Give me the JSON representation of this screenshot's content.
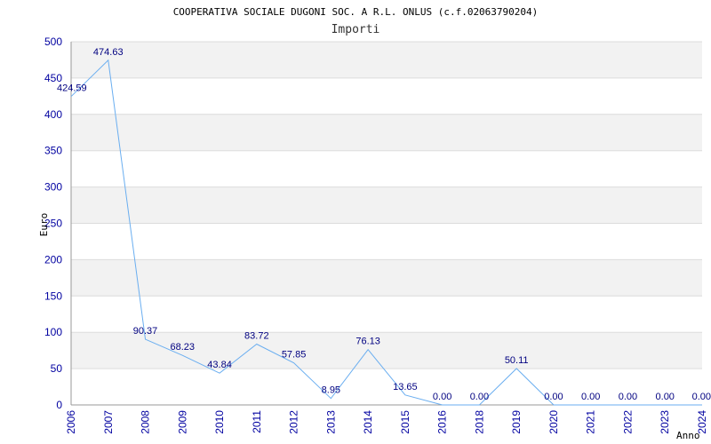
{
  "chart_data": {
    "type": "line",
    "title": "COOPERATIVA SOCIALE DUGONI SOC. A R.L. ONLUS (c.f.02063790204)",
    "subtitle": "Importi",
    "xlabel": "Anno",
    "ylabel": "Euro",
    "ylim": [
      0,
      500
    ],
    "yticks": [
      0,
      50,
      100,
      150,
      200,
      250,
      300,
      350,
      400,
      450,
      500
    ],
    "categories": [
      "2006",
      "2007",
      "2008",
      "2009",
      "2010",
      "2011",
      "2012",
      "2013",
      "2014",
      "2015",
      "2016",
      "2018",
      "2019",
      "2020",
      "2021",
      "2022",
      "2023",
      "2024"
    ],
    "series": [
      {
        "values": [
          424.59,
          474.63,
          90.37,
          68.23,
          43.84,
          83.72,
          57.85,
          8.95,
          76.13,
          13.65,
          0.0,
          0.0,
          50.11,
          0.0,
          0.0,
          0.0,
          0.0,
          0.0
        ],
        "labels": [
          "424.59",
          "474.63",
          "90.37",
          "68.23",
          "43.84",
          "83.72",
          "57.85",
          "8.95",
          "76.13",
          "13.65",
          "0.00",
          "0.00",
          "50.11",
          "0.00",
          "0.00",
          "0.00",
          "0.00",
          "0.00"
        ]
      }
    ],
    "grid": true,
    "colors": {
      "line": "#6aaef0",
      "tick_text": "#0000a0",
      "label_text": "#000080",
      "band": "#f2f2f2",
      "grid": "#dcdcdc"
    }
  }
}
